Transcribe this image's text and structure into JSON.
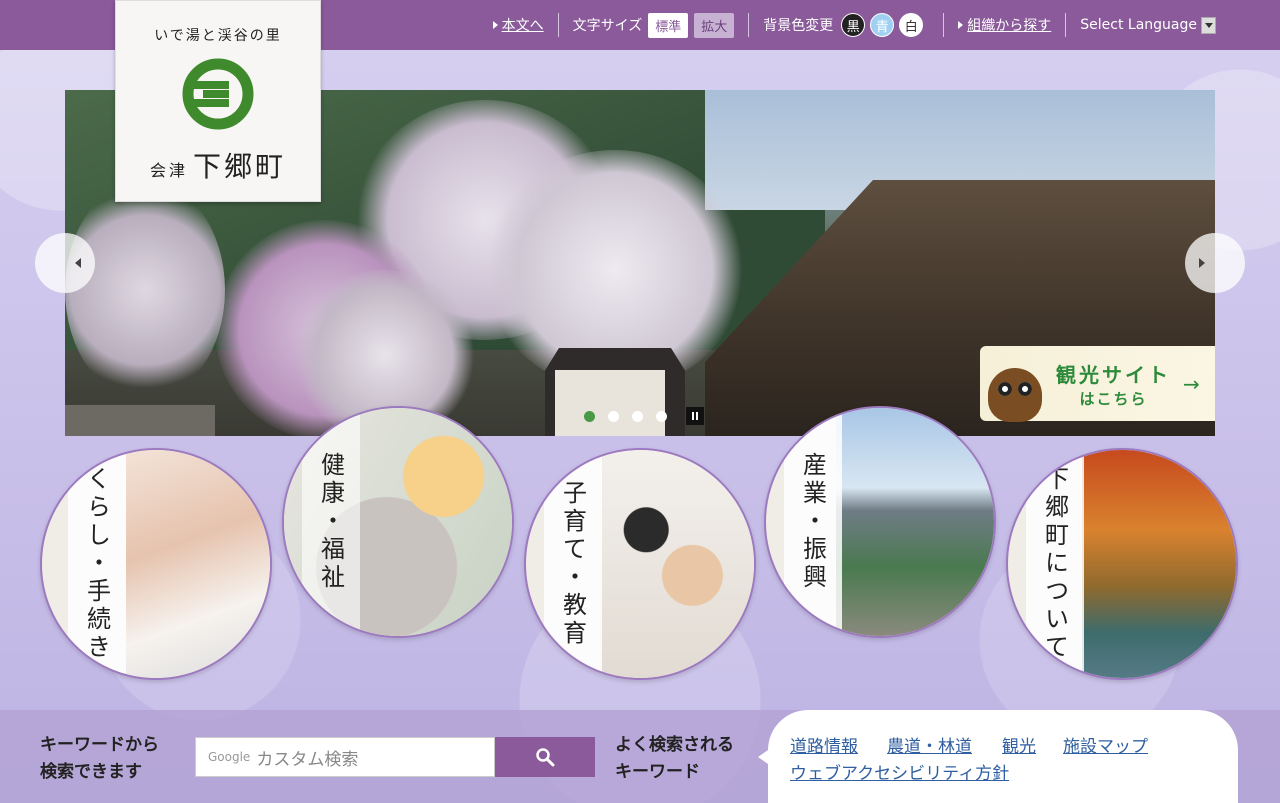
{
  "topbar": {
    "skip_link": "本文へ",
    "text_size_label": "文字サイズ",
    "size_standard": "標準",
    "size_large": "拡大",
    "bg_color_label": "背景色変更",
    "color_black": "黒",
    "color_blue": "青",
    "color_white": "白",
    "org_search": "組織から探す",
    "language": "Select Language"
  },
  "logo": {
    "tagline": "いで湯と渓谷の里",
    "name_small": "会津",
    "name_large": "下郷町",
    "mark_color": "#3f8a2c"
  },
  "hero": {
    "slides_count": 4,
    "active_slide": 1,
    "tourism_line1": "観光サイト",
    "tourism_line2": "はこちら"
  },
  "categories": [
    {
      "label": "くらし・手続き"
    },
    {
      "label": "健康・福祉"
    },
    {
      "label": "子育て・教育"
    },
    {
      "label": "産業・振興"
    },
    {
      "label": "下郷町について"
    }
  ],
  "search": {
    "label_line1": "キーワードから",
    "label_line2": "検索できます",
    "google_mark": "Google",
    "placeholder": "カスタム検索"
  },
  "keywords": {
    "label_line1": "よく検索される",
    "label_line2": "キーワード",
    "items": [
      "道路情報",
      "農道・林道",
      "観光",
      "施設マップ",
      "ウェブアクセシビリティ方針"
    ]
  },
  "colors": {
    "header": "#8a5a9a",
    "accent": "#9d7ac0",
    "link": "#2f5fa0"
  }
}
